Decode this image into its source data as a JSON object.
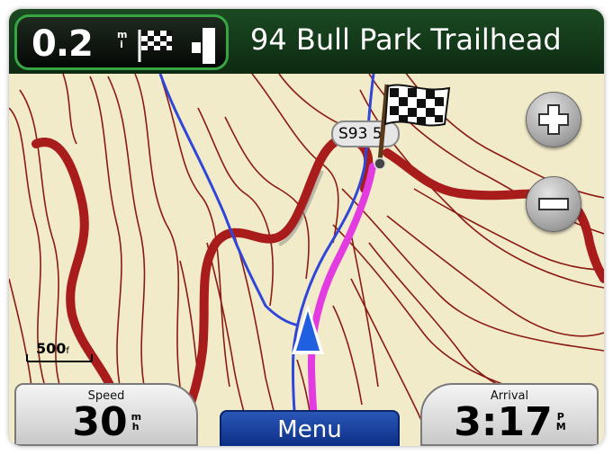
{
  "banner": {
    "distance_value": "0.2",
    "distance_unit_top": "m",
    "distance_unit_bottom": "i",
    "destination": "94 Bull Park Trailhead"
  },
  "map": {
    "road_label": "S93 5",
    "scale_value": "500",
    "scale_unit": "f"
  },
  "zoom": {
    "in_icon": "plus-icon",
    "out_icon": "minus-icon"
  },
  "speed_field": {
    "title": "Speed",
    "value": "30",
    "unit_top": "m",
    "unit_bottom": "h"
  },
  "arrival_field": {
    "title": "Arrival",
    "value": "3:17",
    "unit_top": "P",
    "unit_bottom": "M"
  },
  "menu": {
    "label": "Menu"
  },
  "colors": {
    "banner_green": "#1b4a22",
    "distance_border": "#38a544",
    "route": "#e23be0",
    "trail_blue": "#3355dd",
    "contour_red": "#9a1a1a",
    "map_bg": "#f2ebc9",
    "menu_blue": "#1a45a8"
  }
}
